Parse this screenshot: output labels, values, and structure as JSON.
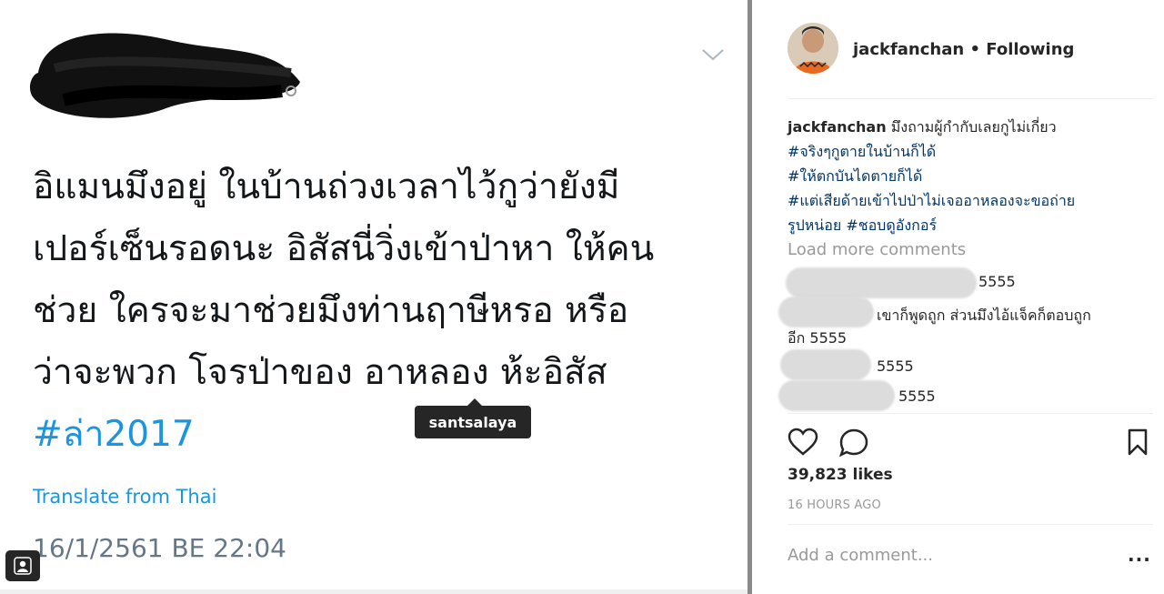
{
  "tweet": {
    "text_lines": [
      "อิแมนมึงอยู่ ในบ้านถ่วงเวลาไว้กูว่ายังมี",
      "เปอร์เซ็นรอดนะ อิสัสนี่วิ่งเข้าป่าหา ให้คน",
      "ช่วย  ใครจะมาช่วยมึงท่านฤาษีหรอ หรือ",
      "ว่าจะพวก โจรป่าของ อาหลอง ห้ะอิสัส"
    ],
    "hashtag": "#ล่า2017",
    "translate": "Translate from Thai",
    "timestamp": "16/1/2561 BE 22:04",
    "tag_tooltip": "santsalaya"
  },
  "post": {
    "username": "jackfanchan",
    "follow_status": "Following",
    "caption_user": "jackfanchan",
    "caption_text": "มึงถามผู้กำกับเลยกูไม่เกี่ยว",
    "caption_tags": [
      "#จริงๆกูตายในบ้านก็ได้",
      "#ให้ตกบันไดตายก็ได้",
      "#แต่เสียด้ายเข้าไปป่าไม่เจออาหลองจะขอถ่าย",
      "รูปหน่อย #ชอบดูอังกอร์"
    ],
    "load_more": "Load more comments",
    "comments": [
      {
        "text": "5555"
      },
      {
        "text": "เขาก็พูดถูก ส่วนมึงไอ้แจ็คก็ตอบถูก",
        "text2": "อีก 5555"
      },
      {
        "text": "5555"
      },
      {
        "text": "5555"
      }
    ],
    "likes": "39,823 likes",
    "time_ago": "16 HOURS AGO",
    "add_comment_placeholder": "Add a comment...",
    "more_label": "..."
  },
  "icons": {
    "like": "heart-icon",
    "comment": "comment-icon",
    "save": "bookmark-icon",
    "options": "chevron-down-icon",
    "tag": "user-tag-icon"
  },
  "colors": {
    "link": "#1b95e0",
    "hashtag_ig": "#003569",
    "muted": "#999999",
    "text": "#262626"
  }
}
